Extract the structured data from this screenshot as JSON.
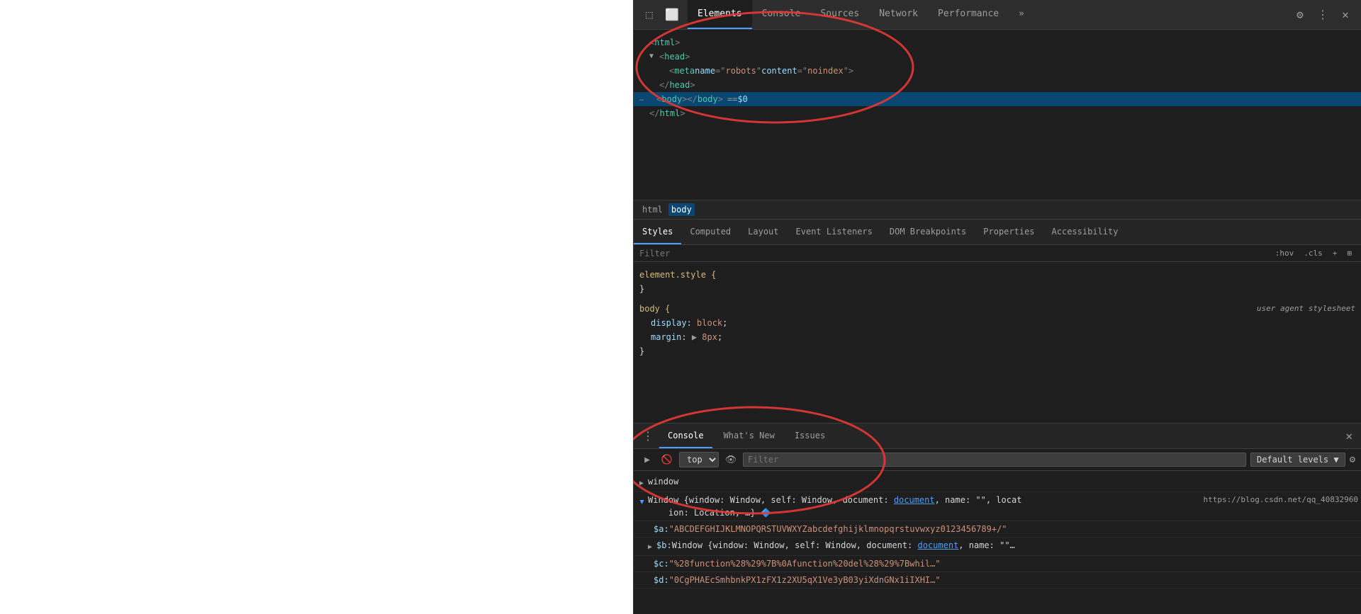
{
  "devtools": {
    "tabs": [
      {
        "id": "elements",
        "label": "Elements",
        "active": true
      },
      {
        "id": "console",
        "label": "Console",
        "active": false
      },
      {
        "id": "sources",
        "label": "Sources",
        "active": false
      },
      {
        "id": "network",
        "label": "Network",
        "active": false
      },
      {
        "id": "performance",
        "label": "Performance",
        "active": false
      },
      {
        "id": "more",
        "label": "»",
        "active": false
      }
    ],
    "toolbar_icons": {
      "inspect": "⬚",
      "device": "⬜",
      "settings": "⚙",
      "more": "⋮",
      "close": "✕"
    }
  },
  "elements_tree": {
    "lines": [
      {
        "indent": 0,
        "content": "<html>",
        "type": "tag"
      },
      {
        "indent": 1,
        "arrow": "▼",
        "content": "<head>",
        "type": "tag"
      },
      {
        "indent": 2,
        "content": "<meta name=\"robots\" content=\"noindex\">",
        "type": "tag"
      },
      {
        "indent": 1,
        "content": "</head>",
        "type": "tag"
      },
      {
        "indent": 1,
        "content": "<body></body>  == $0",
        "type": "selected"
      },
      {
        "indent": 0,
        "content": "</html>",
        "type": "tag"
      }
    ]
  },
  "breadcrumb": {
    "items": [
      {
        "label": "html",
        "active": false
      },
      {
        "label": "body",
        "active": true
      }
    ]
  },
  "styles_tabs": [
    {
      "label": "Styles",
      "active": true
    },
    {
      "label": "Computed",
      "active": false
    },
    {
      "label": "Layout",
      "active": false
    },
    {
      "label": "Event Listeners",
      "active": false
    },
    {
      "label": "DOM Breakpoints",
      "active": false
    },
    {
      "label": "Properties",
      "active": false
    },
    {
      "label": "Accessibility",
      "active": false
    }
  ],
  "filter": {
    "placeholder": "Filter",
    "hov_label": ":hov",
    "cls_label": ".cls",
    "add_label": "+",
    "toggle_label": "⊞"
  },
  "style_rules": [
    {
      "selector": "element.style {",
      "close": "}",
      "properties": []
    },
    {
      "selector": "body {",
      "source": "user agent stylesheet",
      "close": "}",
      "properties": [
        {
          "name": "display",
          "colon": ":",
          "value": "block",
          "semicolon": ";"
        },
        {
          "name": "margin",
          "colon": ":",
          "value": "▶ 8px",
          "semicolon": ";",
          "hasArrow": true
        }
      ]
    }
  ],
  "console": {
    "tabs": [
      {
        "label": "Console",
        "active": true
      },
      {
        "label": "What's New",
        "active": false
      },
      {
        "label": "Issues",
        "active": false
      }
    ],
    "filter_placeholder": "Filter",
    "top_select": "top",
    "levels_label": "Default levels ▼",
    "lines": [
      {
        "type": "collapsible",
        "arrow": "▶",
        "text": "window"
      },
      {
        "type": "expanded",
        "arrow": "◀",
        "text": "Window {window: Window, self: Window, document: ",
        "link": "document",
        "text2": ", name: \"\", locat",
        "continuation": "ion: Location, …} 🔷"
      },
      {
        "type": "property",
        "indent": 2,
        "key": "$a:",
        "value": "\"ABCDEFGHIJKLMNOPQRSTUVWXYZabcdefghijklmnopqrstuvwxyz0123456789+/\""
      },
      {
        "type": "property-collapsible",
        "indent": 2,
        "arrow": "▶",
        "key": "$b:",
        "value": "Window {window: Window, self: Window, document: ",
        "link": "document",
        "value2": ", name: \"\"…"
      },
      {
        "type": "property",
        "indent": 2,
        "key": "$c:",
        "value": "\"%28function%28%29%7B%0Afunction%20del%28%29%7Bwhil…\""
      },
      {
        "type": "property",
        "indent": 2,
        "key": "$d:",
        "value": "\"0CgPHAEcSmhbnkPX1zFX1z2XU5qX1Ve3yB03yiXdnGNx1iIXHI…\""
      }
    ],
    "url": "https://blog.csdn.net/qq_40832960"
  }
}
